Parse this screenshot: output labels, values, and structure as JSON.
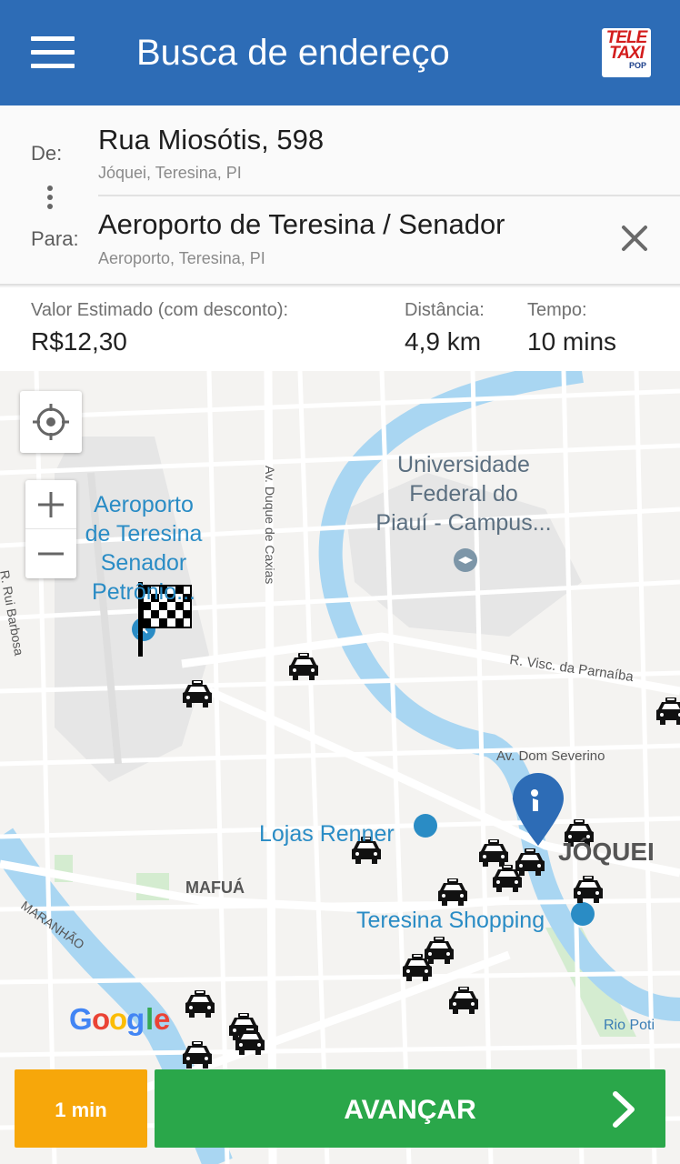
{
  "app_bar": {
    "title": "Busca de endereço",
    "logo_lines": [
      "TELE",
      "TAXI",
      "POP"
    ]
  },
  "route": {
    "from_label": "De:",
    "from_main": "Rua Miosótis, 598",
    "from_sub": "Jóquei, Teresina, PI",
    "to_label": "Para:",
    "to_main": "Aeroporto de Teresina / Senador",
    "to_sub": "Aeroporto, Teresina, PI"
  },
  "estimate": {
    "price_label": "Valor Estimado (com desconto):",
    "price": "R$12,30",
    "distance_label": "Distância:",
    "distance": "4,9 km",
    "time_label": "Tempo:",
    "time": "10 mins"
  },
  "map": {
    "labels": {
      "airport": [
        "Aeroporto",
        "de Teresina",
        "Senador",
        "Petrônio..."
      ],
      "university": [
        "Universidade",
        "Federal do",
        "Piauí - Campus..."
      ],
      "duque": "Av. Duque de Caxias",
      "rui": "R. Rui Barbosa",
      "visc": "R. Visc. da Parnaíba",
      "dom": "Av. Dom Severino",
      "renner": "Lojas Renner",
      "joquei": "JÓQUEI",
      "mafua": "MAFUÁ",
      "shopping": "Teresina Shopping",
      "maranhao": "MARANHÃO",
      "poti": "Rio Poti",
      "google": [
        "G",
        "o",
        "o",
        "g",
        "l",
        "e"
      ]
    },
    "colors": {
      "road": "#ffffff",
      "water": "#a9d6f2",
      "park": "#d4ecd0",
      "poi": "#2a8cc5"
    }
  },
  "actions": {
    "eta": "1 min",
    "advance": "AVANÇAR"
  }
}
